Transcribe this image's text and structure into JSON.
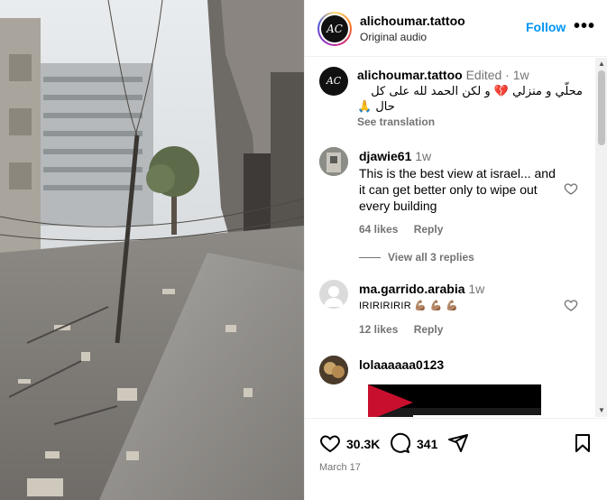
{
  "post": {
    "username": "alichoumar.tattoo",
    "subtitle": "Original audio",
    "follow_label": "Follow",
    "more_label": "•••",
    "avatar_initials": "AC"
  },
  "caption": {
    "username": "alichoumar.tattoo",
    "edited": "Edited",
    "dot": "·",
    "time": "1w",
    "text_line1": "محلّي و منزلي 💔 و لكن الحمد لله على كل",
    "text_line2": "حال 🙏",
    "see_translation": "See translation"
  },
  "comments": [
    {
      "username": "djawie61",
      "time": "1w",
      "lines": [
        "This is the best view at israel... and",
        "it can get better only to wipe out",
        "every building"
      ],
      "likes": "64 likes",
      "reply": "Reply",
      "view_replies": "View all 3 replies"
    },
    {
      "username": "ma.garrido.arabia",
      "time": "1w",
      "lines": [
        "IRIRIRIRIR 💪🏽 💪🏽 💪🏽"
      ],
      "likes": "12 likes",
      "reply": "Reply"
    },
    {
      "username": "lolaaaaaa0123"
    }
  ],
  "footer": {
    "likes_count": "30.3K",
    "comments_count": "341",
    "date": "March 17"
  },
  "colors": {
    "accent": "#0095f6",
    "muted": "#737373"
  }
}
